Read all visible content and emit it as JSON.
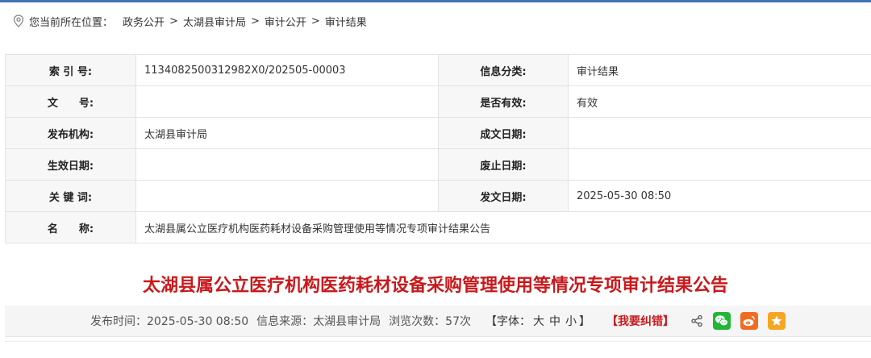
{
  "breadcrumb": {
    "prefix": "您当前所在位置：",
    "items": [
      "政务公开",
      "太湖县审计局",
      "审计公开",
      "审计结果"
    ],
    "separator": ">"
  },
  "info_table": {
    "rows": [
      {
        "k1": "索 引 号:",
        "v1": "1134082500312982X0/202505-00003",
        "k2": "信息分类:",
        "v2": "审计结果"
      },
      {
        "k1": "文　　号:",
        "v1": "",
        "k2": "是否有效:",
        "v2": "有效"
      },
      {
        "k1": "发布机构:",
        "v1": "太湖县审计局",
        "k2": "成文日期:",
        "v2": ""
      },
      {
        "k1": "生效日期:",
        "v1": "",
        "k2": "废止日期:",
        "v2": ""
      },
      {
        "k1": "关 键 词:",
        "v1": "",
        "k2": "发文日期:",
        "v2": "2025-05-30 08:50"
      }
    ],
    "name_row": {
      "k": "名　　称:",
      "v": "太湖县属公立医疗机构医药耗材设备采购管理使用等情况专项审计结果公告"
    }
  },
  "article": {
    "title": "太湖县属公立医疗机构医药耗材设备采购管理使用等情况专项审计结果公告"
  },
  "meta": {
    "publish_time": "发布时间：2025-05-30 08:50",
    "source": "信息来源：太湖县审计局",
    "views": "浏览次数：57次",
    "font_label": "【字体：",
    "font_large": "大",
    "font_medium": "中",
    "font_small": "小",
    "font_end": "】",
    "correction": "【我要纠错】"
  },
  "share": {
    "icons": [
      "share-icon",
      "wechat-icon",
      "weibo-icon",
      "favorite-icon"
    ],
    "colors": {
      "wechat": "#21b635",
      "weibo": "#f36b22",
      "favorite": "#f5a623"
    }
  },
  "colors": {
    "accent": "#c8191c",
    "label_bg": "#f7f7f7",
    "border": "#e3e3e3",
    "top_bar": "#3f72b5"
  }
}
